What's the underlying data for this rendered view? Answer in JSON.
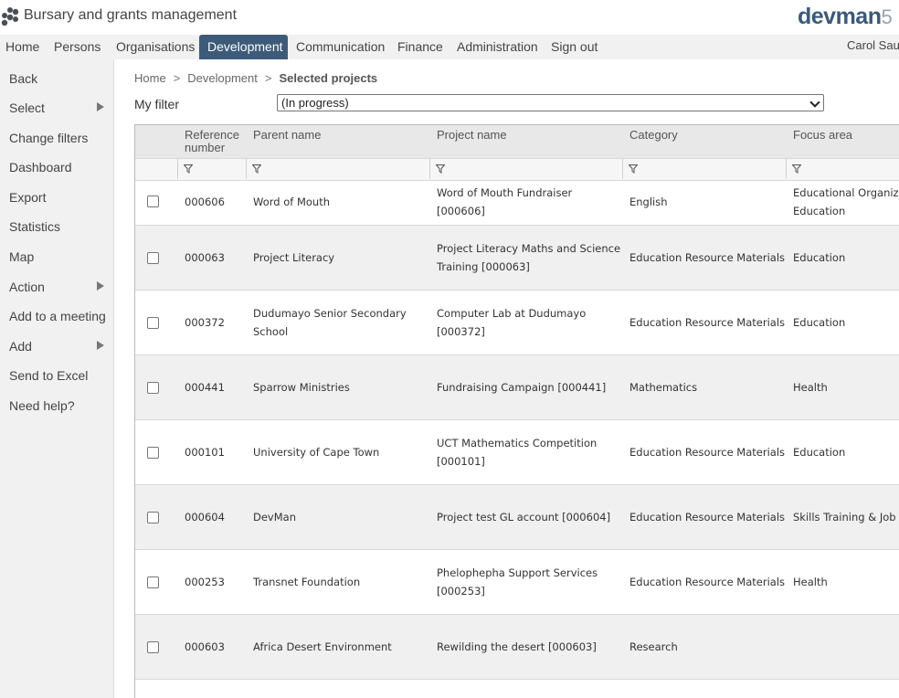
{
  "header": {
    "app_title": "Bursary and grants management",
    "brand": "devman",
    "brand_version": "5"
  },
  "nav": {
    "items": [
      "Home",
      "Persons",
      "Organisations",
      "Development",
      "Communication",
      "Finance",
      "Administration",
      "Sign out"
    ],
    "active": "Development",
    "user": "Carol Sau"
  },
  "sidebar": {
    "items": [
      {
        "label": "Back"
      },
      {
        "label": "Select",
        "submenu": true
      },
      {
        "label": "Change filters"
      },
      {
        "label": "Dashboard"
      },
      {
        "label": "Export"
      },
      {
        "label": "Statistics"
      },
      {
        "label": "Map"
      },
      {
        "label": "Action",
        "submenu": true
      },
      {
        "label": "Add to a meeting"
      },
      {
        "label": "Add",
        "submenu": true
      },
      {
        "label": "Send to Excel"
      },
      {
        "label": "Need help?"
      }
    ]
  },
  "breadcrumb": [
    "Home",
    "Development",
    "Selected projects"
  ],
  "filter": {
    "label": "My filter",
    "value": "(In progress)"
  },
  "table": {
    "columns": [
      "Reference number",
      "Parent name",
      "Project name",
      "Category",
      "Focus area"
    ],
    "rows": [
      {
        "ref": "000606",
        "parent": "Word of Mouth",
        "project": [
          "Word of Mouth Fundraiser",
          "[000606]"
        ],
        "category": "English",
        "focus": [
          "Educational Organiza",
          "Education"
        ]
      },
      {
        "ref": "000063",
        "parent": "Project Literacy",
        "project": [
          "Project Literacy Maths and Science",
          "Training [000063]"
        ],
        "category": "Education Resource Materials",
        "focus": [
          "Education"
        ]
      },
      {
        "ref": "000372",
        "parent": "Dudumayo Senior Secondary School",
        "project": [
          "Computer Lab at Dudumayo",
          "[000372]"
        ],
        "category": "Education Resource Materials",
        "focus": [
          "Education"
        ]
      },
      {
        "ref": "000441",
        "parent": "Sparrow Ministries",
        "project": [
          "Fundraising Campaign [000441]"
        ],
        "category": "Mathematics",
        "focus": [
          "Health"
        ]
      },
      {
        "ref": "000101",
        "parent": "University of Cape Town",
        "project": [
          "UCT Mathematics Competition",
          "[000101]"
        ],
        "category": "Education Resource Materials",
        "focus": [
          "Education"
        ]
      },
      {
        "ref": "000604",
        "parent": "DevMan",
        "project": [
          "Project test GL account [000604]"
        ],
        "category": "Education Resource Materials",
        "focus": [
          "Skills Training & Job C"
        ]
      },
      {
        "ref": "000253",
        "parent": "Transnet Foundation",
        "project": [
          "Phelophepha Support Services",
          "[000253]"
        ],
        "category": "Education Resource Materials",
        "focus": [
          "Health"
        ]
      },
      {
        "ref": "000603",
        "parent": "Africa Desert Environment",
        "project": [
          "Rewilding the desert [000603]"
        ],
        "category": "Research",
        "focus": []
      }
    ]
  },
  "colors": {
    "nav_active": "#3d5b78",
    "brand": "#3b5a76"
  }
}
